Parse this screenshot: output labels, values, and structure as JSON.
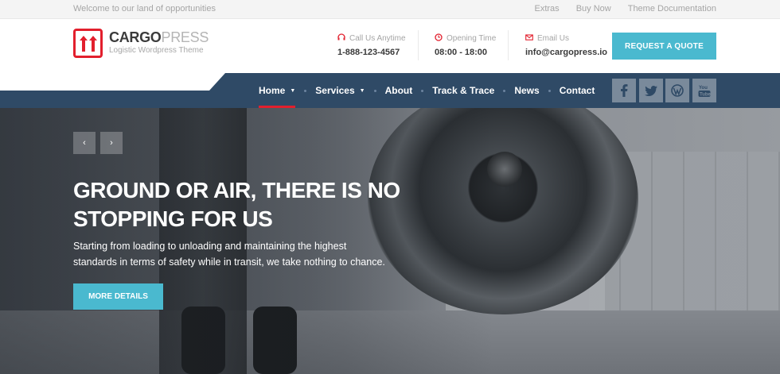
{
  "topbar": {
    "welcome": "Welcome to our land of opportunities",
    "links": [
      "Extras",
      "Buy Now",
      "Theme Documentation"
    ]
  },
  "logo": {
    "brand_primary": "CARGO",
    "brand_secondary": "PRESS",
    "tagline": "Logistic Wordpress Theme",
    "icon": "box-arrows-icon"
  },
  "contact": [
    {
      "icon": "headphones-icon",
      "label": "Call Us Anytime",
      "value": "1-888-123-4567"
    },
    {
      "icon": "clock-icon",
      "label": "Opening Time",
      "value": "08:00 - 18:00"
    },
    {
      "icon": "envelope-icon",
      "label": "Email Us",
      "value": "info@cargopress.io"
    }
  ],
  "quote_button": "REQUEST A QUOTE",
  "nav": [
    {
      "label": "Home",
      "dropdown": true,
      "active": true
    },
    {
      "label": "Services",
      "dropdown": true,
      "active": false
    },
    {
      "label": "About",
      "dropdown": false,
      "active": false
    },
    {
      "label": "Track & Trace",
      "dropdown": false,
      "active": false
    },
    {
      "label": "News",
      "dropdown": false,
      "active": false
    },
    {
      "label": "Contact",
      "dropdown": false,
      "active": false
    }
  ],
  "social": [
    "facebook-icon",
    "twitter-icon",
    "wordpress-icon",
    "youtube-icon"
  ],
  "hero": {
    "title": "GROUND OR AIR, THERE IS NO STOPPING FOR US",
    "text": "Starting from loading to unloading and maintaining the highest standards in terms of safety while in transit, we take nothing to chance.",
    "button": "MORE DETAILS",
    "prev_arrow": "‹",
    "next_arrow": "›"
  },
  "colors": {
    "accent": "#4ab9cf",
    "brand_red": "#e21f2d",
    "nav_bg": "#2f4a66"
  }
}
